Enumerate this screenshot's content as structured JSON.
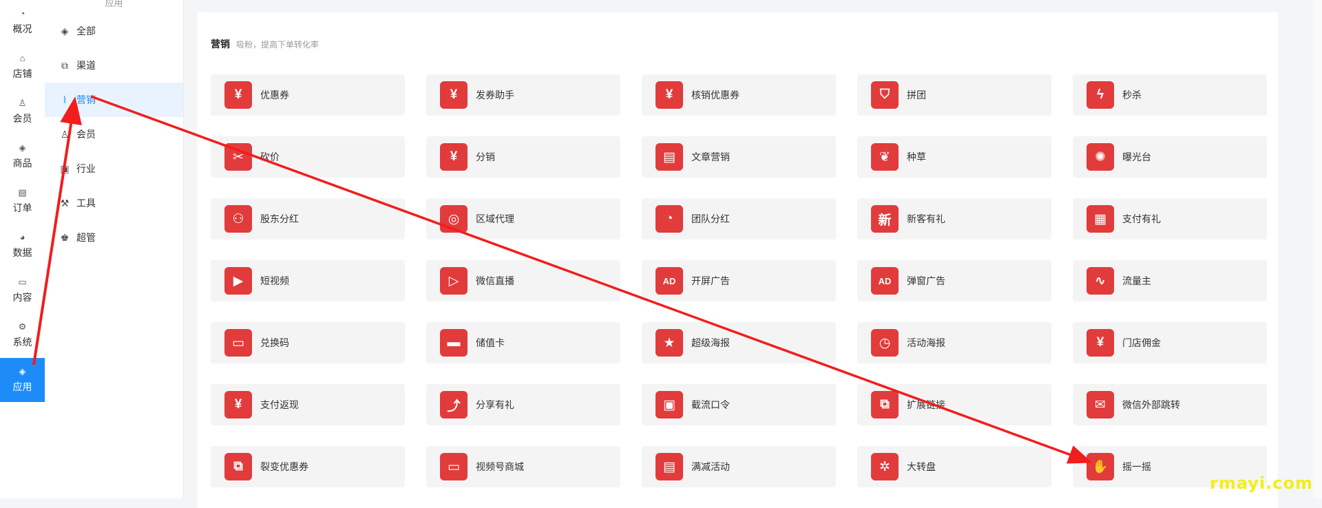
{
  "rail": {
    "items": [
      {
        "label": "概况",
        "icon": "gauge-icon",
        "glyph": "◔"
      },
      {
        "label": "店铺",
        "icon": "store-icon",
        "glyph": "⌂"
      },
      {
        "label": "会员",
        "icon": "user-icon",
        "glyph": "♙"
      },
      {
        "label": "商品",
        "icon": "cube-icon",
        "glyph": "◈"
      },
      {
        "label": "订单",
        "icon": "order-icon",
        "glyph": "▤"
      },
      {
        "label": "数据",
        "icon": "pie-icon",
        "glyph": "◕"
      },
      {
        "label": "内容",
        "icon": "folder-icon",
        "glyph": "▭"
      },
      {
        "label": "系统",
        "icon": "settings-icon",
        "glyph": "⚙"
      },
      {
        "label": "应用",
        "icon": "app-cube-icon",
        "glyph": "◈"
      }
    ],
    "active_index": 8
  },
  "subnav": {
    "header": "应用",
    "items": [
      {
        "label": "全部",
        "icon": "cube-icon",
        "glyph": "◈"
      },
      {
        "label": "渠道",
        "icon": "channel-icon",
        "glyph": "⧉"
      },
      {
        "label": "营销",
        "icon": "trend-icon",
        "glyph": "⌇"
      },
      {
        "label": "会员",
        "icon": "user-icon",
        "glyph": "♙"
      },
      {
        "label": "行业",
        "icon": "industry-icon",
        "glyph": "▣"
      },
      {
        "label": "工具",
        "icon": "wrench-icon",
        "glyph": "⚒"
      },
      {
        "label": "超管",
        "icon": "admin-icon",
        "glyph": "♚"
      }
    ],
    "active_index": 2
  },
  "section": {
    "title": "营销",
    "desc": "吸粉，提高下单转化率"
  },
  "cards": [
    {
      "label": "优惠券",
      "icon": "coupon-icon",
      "glyph": "¥"
    },
    {
      "label": "发券助手",
      "icon": "coupon-helper-icon",
      "glyph": "¥"
    },
    {
      "label": "核销优惠券",
      "icon": "verify-coupon-icon",
      "glyph": "¥"
    },
    {
      "label": "拼团",
      "icon": "group-buy-icon",
      "glyph": "⛉"
    },
    {
      "label": "秒杀",
      "icon": "flash-sale-icon",
      "glyph": "ϟ"
    },
    {
      "label": "砍价",
      "icon": "bargain-icon",
      "glyph": "✂"
    },
    {
      "label": "分销",
      "icon": "distribution-icon",
      "glyph": "¥"
    },
    {
      "label": "文章营销",
      "icon": "article-icon",
      "glyph": "▤"
    },
    {
      "label": "种草",
      "icon": "sprout-icon",
      "glyph": "❦"
    },
    {
      "label": "曝光台",
      "icon": "exposure-icon",
      "glyph": "✺"
    },
    {
      "label": "股东分红",
      "icon": "dividend-icon",
      "glyph": "⚇"
    },
    {
      "label": "区域代理",
      "icon": "region-agent-icon",
      "glyph": "◎"
    },
    {
      "label": "团队分红",
      "icon": "team-dividend-icon",
      "glyph": "◔"
    },
    {
      "label": "新客有礼",
      "icon": "new-customer-icon",
      "glyph": "新"
    },
    {
      "label": "支付有礼",
      "icon": "pay-gift-icon",
      "glyph": "▦"
    },
    {
      "label": "短视频",
      "icon": "video-icon",
      "glyph": "▶"
    },
    {
      "label": "微信直播",
      "icon": "live-icon",
      "glyph": "▷"
    },
    {
      "label": "开屏广告",
      "icon": "splash-ad-icon",
      "glyph": "AD"
    },
    {
      "label": "弹窗广告",
      "icon": "popup-ad-icon",
      "glyph": "AD"
    },
    {
      "label": "流量主",
      "icon": "traffic-icon",
      "glyph": "∿"
    },
    {
      "label": "兑换码",
      "icon": "redeem-code-icon",
      "glyph": "▭"
    },
    {
      "label": "储值卡",
      "icon": "stored-card-icon",
      "glyph": "▬"
    },
    {
      "label": "超级海报",
      "icon": "poster-icon",
      "glyph": "★"
    },
    {
      "label": "活动海报",
      "icon": "event-poster-icon",
      "glyph": "◷"
    },
    {
      "label": "门店佣金",
      "icon": "store-commission-icon",
      "glyph": "¥"
    },
    {
      "label": "支付返现",
      "icon": "cashback-icon",
      "glyph": "¥"
    },
    {
      "label": "分享有礼",
      "icon": "share-gift-icon",
      "glyph": "⤴"
    },
    {
      "label": "截流口令",
      "icon": "password-icon",
      "glyph": "▣"
    },
    {
      "label": "扩展链接",
      "icon": "link-icon",
      "glyph": "⧉"
    },
    {
      "label": "微信外部跳转",
      "icon": "wechat-jump-icon",
      "glyph": "✉"
    },
    {
      "label": "裂变优惠券",
      "icon": "fission-coupon-icon",
      "glyph": "⧉"
    },
    {
      "label": "视频号商城",
      "icon": "video-mall-icon",
      "glyph": "▭"
    },
    {
      "label": "满减活动",
      "icon": "discount-icon",
      "glyph": "▤"
    },
    {
      "label": "大转盘",
      "icon": "wheel-icon",
      "glyph": "✲"
    },
    {
      "label": "摇一摇",
      "icon": "shake-icon",
      "glyph": "✋"
    }
  ],
  "colors": {
    "accent": "#1d8cf8",
    "icon_bg": "#e23b3b",
    "annotation": "#f21d1d"
  },
  "watermark": "rmayi.com"
}
